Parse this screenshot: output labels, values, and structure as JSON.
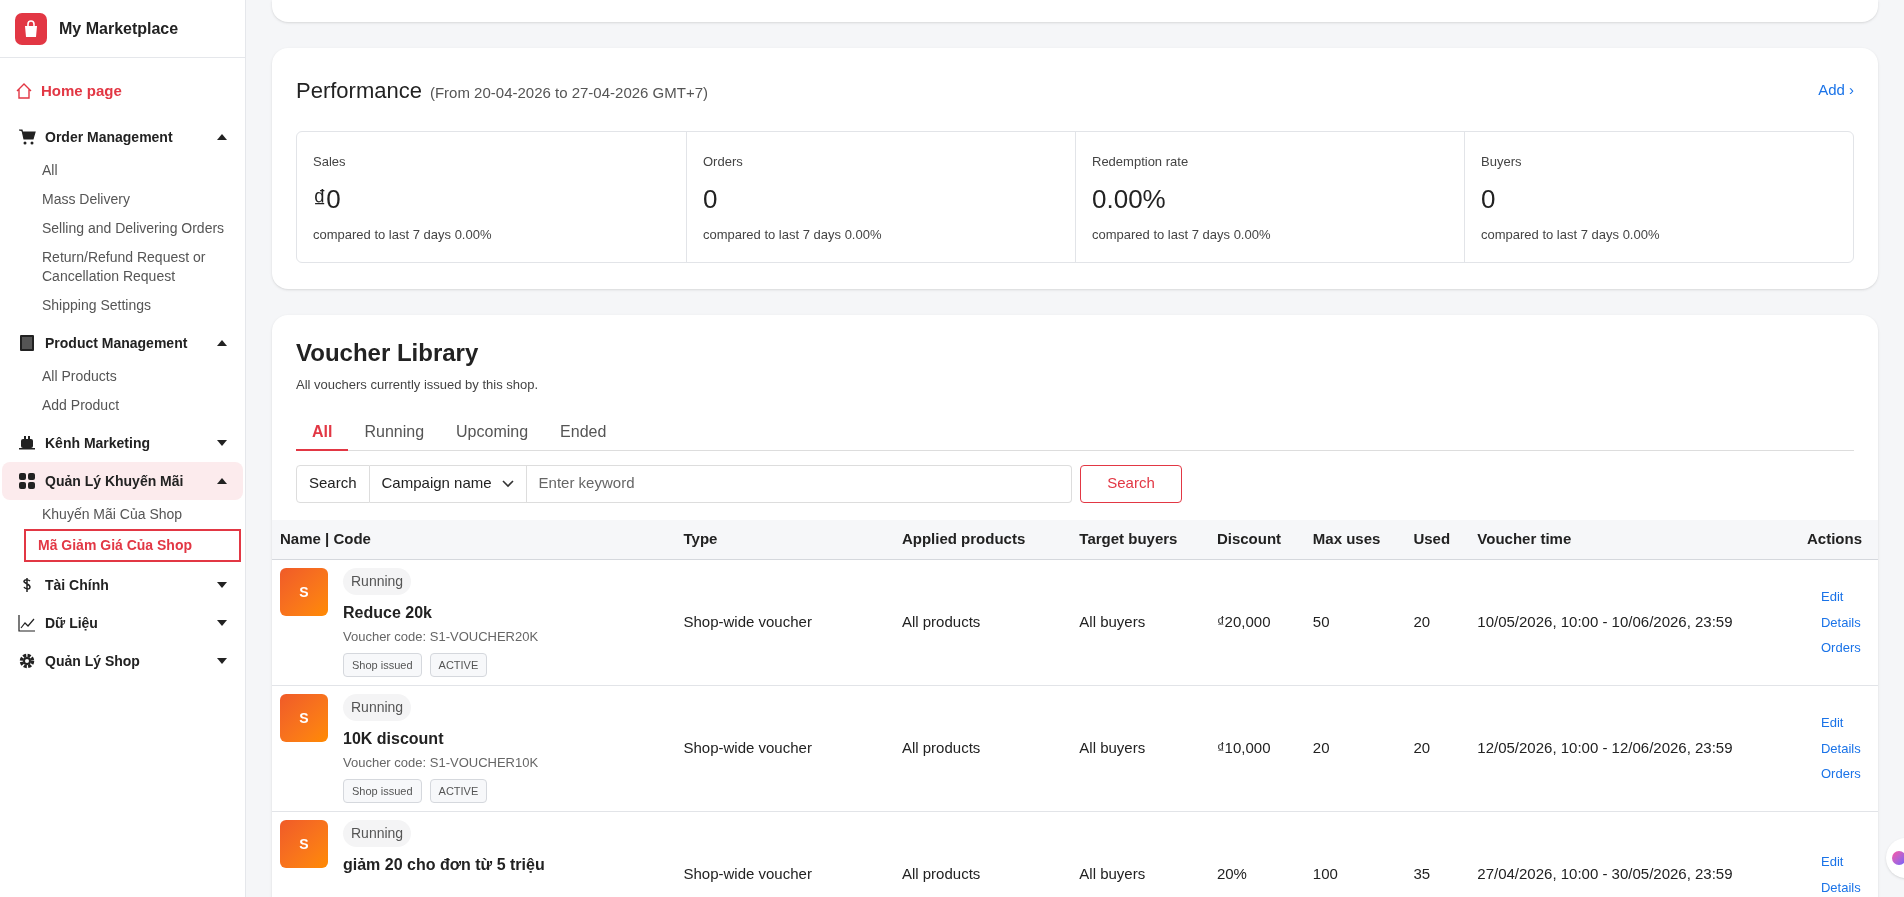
{
  "brand": {
    "name": "My Marketplace"
  },
  "sidebar": {
    "items": [
      {
        "kind": "link",
        "label": "Home page",
        "selected": true
      },
      {
        "kind": "group",
        "label": "Order Management",
        "expanded": true,
        "selected": false,
        "children": [
          {
            "label": "All",
            "selected": false
          },
          {
            "label": "Mass Delivery",
            "selected": false
          },
          {
            "label": "Selling and Delivering Orders",
            "selected": false
          },
          {
            "label": "Return/Refund Request or Cancellation Request",
            "selected": false
          },
          {
            "label": "Shipping Settings",
            "selected": false
          }
        ]
      },
      {
        "kind": "group",
        "label": "Product Management",
        "expanded": true,
        "selected": false,
        "children": [
          {
            "label": "All Products",
            "selected": false
          },
          {
            "label": "Add Product",
            "selected": false
          }
        ]
      },
      {
        "kind": "group",
        "label": "Kênh Marketing",
        "expanded": false,
        "selected": false
      },
      {
        "kind": "group",
        "label": "Quản Lý Khuyến Mãi",
        "expanded": true,
        "selected": true,
        "children": [
          {
            "label": "Khuyến Mãi Của Shop",
            "selected": false
          },
          {
            "label": "Mã Giảm Giá Của Shop",
            "selected": true
          }
        ]
      },
      {
        "kind": "group",
        "label": "Tài Chính",
        "expanded": false,
        "selected": false
      },
      {
        "kind": "group",
        "label": "Dữ Liệu",
        "expanded": false,
        "selected": false
      },
      {
        "kind": "group",
        "label": "Quản Lý Shop",
        "expanded": false,
        "selected": false
      }
    ]
  },
  "performance": {
    "title": "Performance",
    "range": "(From 20-04-2026 to 27-04-2026 GMT+7)",
    "link": "Add ›",
    "metrics": [
      {
        "label": "Sales",
        "value": "₫0",
        "compare": "compared to last 7 days 0.00%"
      },
      {
        "label": "Orders",
        "value": "0",
        "compare": "compared to last 7 days 0.00%"
      },
      {
        "label": "Redemption rate",
        "value": "0.00%",
        "compare": "compared to last 7 days 0.00%"
      },
      {
        "label": "Buyers",
        "value": "0",
        "compare": "compared to last 7 days 0.00%"
      }
    ]
  },
  "voucher_library": {
    "title": "Voucher Library",
    "subtitle": "All vouchers currently issued by this shop.",
    "tabs": [
      {
        "label": "All",
        "selected": true
      },
      {
        "label": "Running",
        "selected": false
      },
      {
        "label": "Upcoming",
        "selected": false
      },
      {
        "label": "Ended",
        "selected": false
      }
    ],
    "search": {
      "prefix": "Search",
      "field_select": "Campaign name",
      "placeholder": "Enter keyword",
      "button": "Search"
    },
    "table": {
      "columns": [
        "Name | Code",
        "Type",
        "Applied products",
        "Target buyers",
        "Discount",
        "Max uses",
        "Used",
        "Voucher time",
        "Actions"
      ],
      "rows": [
        {
          "avatar": "S",
          "status": "Running",
          "name": "Reduce 20k",
          "code": "Voucher code: S1-VOUCHER20K",
          "tags": [
            "Shop issued",
            "ACTIVE"
          ],
          "type": "Shop-wide voucher",
          "applied": "All products",
          "target": "All buyers",
          "discount": "₫20,000",
          "max_uses": "50",
          "used": "20",
          "time": "10/05/2026, 10:00 - 10/06/2026, 23:59",
          "actions": [
            "Edit",
            "Details",
            "Orders"
          ]
        },
        {
          "avatar": "S",
          "status": "Running",
          "name": "10K discount",
          "code": "Voucher code: S1-VOUCHER10K",
          "tags": [
            "Shop issued",
            "ACTIVE"
          ],
          "type": "Shop-wide voucher",
          "applied": "All products",
          "target": "All buyers",
          "discount": "₫10,000",
          "max_uses": "20",
          "used": "20",
          "time": "12/05/2026, 10:00 - 12/06/2026, 23:59",
          "actions": [
            "Edit",
            "Details",
            "Orders"
          ]
        },
        {
          "avatar": "S",
          "status": "Running",
          "name": "giảm 20 cho đơn từ 5 triệu",
          "type": "Shop-wide voucher",
          "applied": "All products",
          "target": "All buyers",
          "discount": "20%",
          "max_uses": "100",
          "used": "35",
          "time": "27/04/2026, 10:00 - 30/05/2026, 23:59",
          "actions": [
            "Edit",
            "Details"
          ]
        }
      ]
    }
  }
}
